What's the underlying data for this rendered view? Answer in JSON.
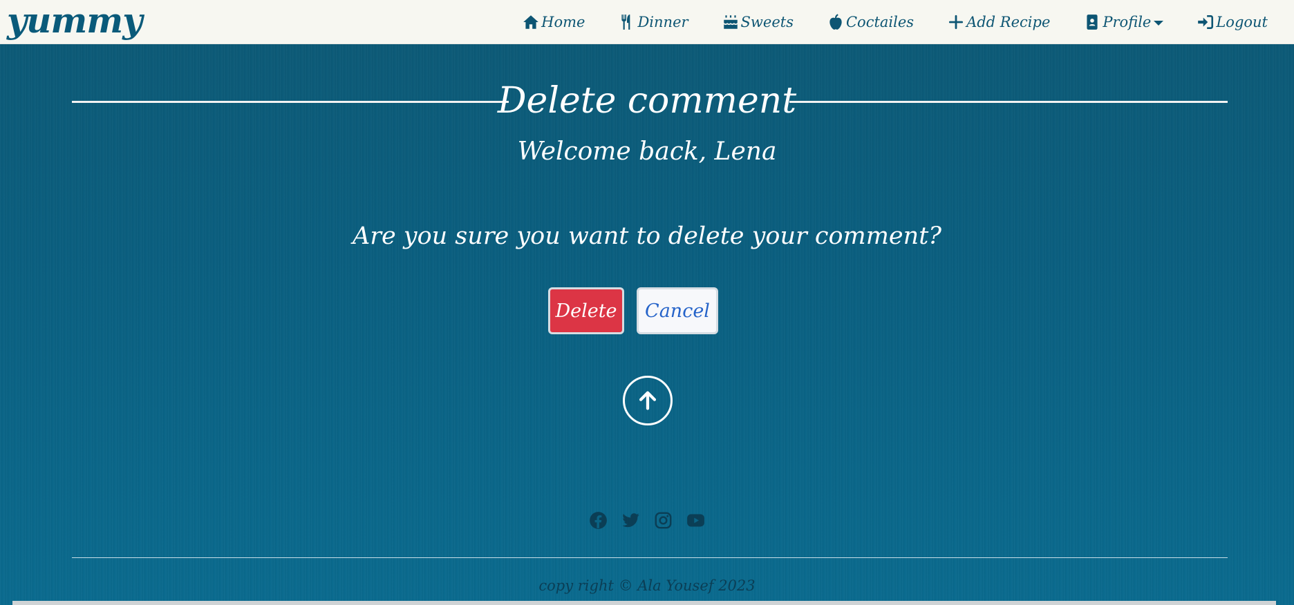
{
  "brand": "yummy",
  "nav": {
    "items": [
      {
        "label": "Home",
        "icon": "home-icon"
      },
      {
        "label": "Dinner",
        "icon": "utensils-icon"
      },
      {
        "label": "Sweets",
        "icon": "cake-icon"
      },
      {
        "label": "Coctailes",
        "icon": "apple-icon"
      },
      {
        "label": "Add Recipe",
        "icon": "plus-icon"
      },
      {
        "label": "Profile",
        "icon": "profile-card-icon"
      },
      {
        "label": "Logout",
        "icon": "logout-icon"
      }
    ]
  },
  "main": {
    "title": "Delete comment",
    "welcome": "Welcome back, Lena",
    "question": "Are you sure you want to delete your comment?",
    "delete_label": "Delete",
    "cancel_label": "Cancel"
  },
  "footer": {
    "socials": [
      "facebook-icon",
      "twitter-icon",
      "instagram-icon",
      "youtube-icon"
    ],
    "copyright": "copy right © Ala Yousef 2023"
  },
  "colors": {
    "brand": "#0a5a7a",
    "nav_text": "#0d5573",
    "background": "#0a6384",
    "delete": "#dc3545",
    "cancel_text": "#2563c9"
  }
}
